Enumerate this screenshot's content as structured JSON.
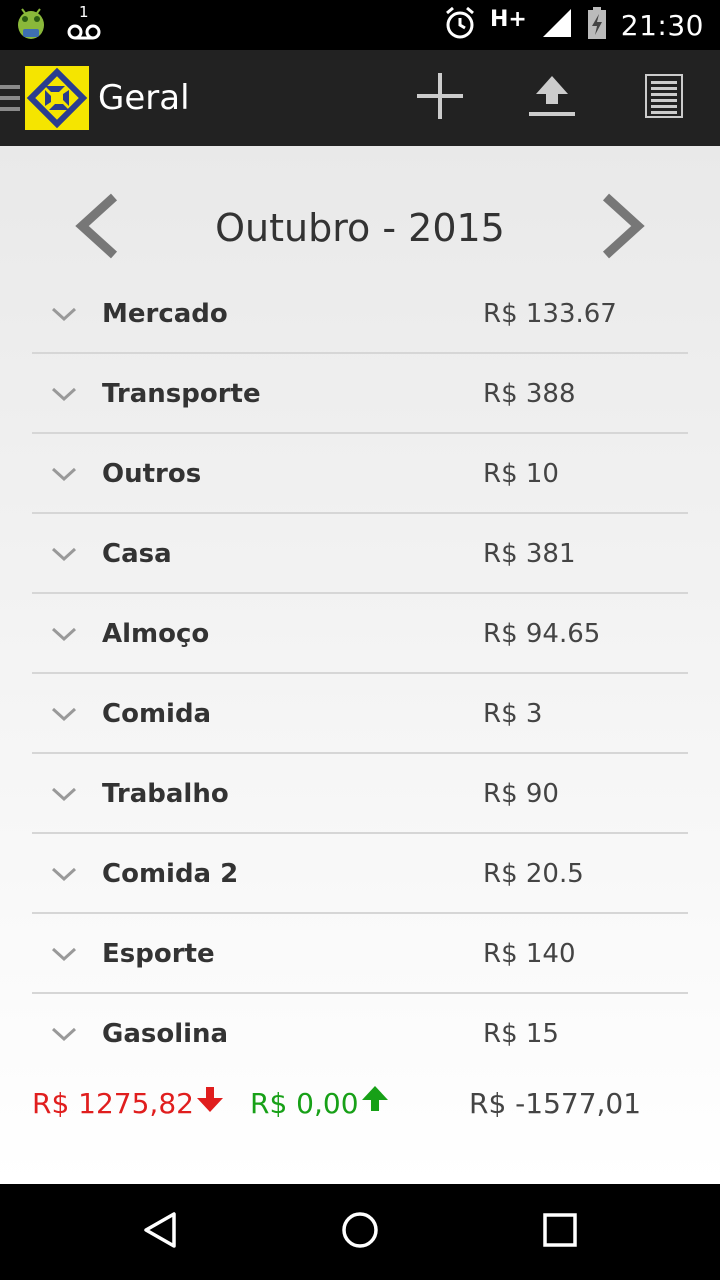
{
  "status_bar": {
    "voicemail_count": "1",
    "network_type": "H+",
    "time": "21:30",
    "icons": [
      "android-debug-icon",
      "voicemail-icon",
      "alarm-icon",
      "signal-icon",
      "battery-charging-icon"
    ]
  },
  "action_bar": {
    "title": "Geral",
    "icons": [
      "drawer-menu-icon",
      "app-logo",
      "add-icon",
      "upload-icon",
      "list-icon"
    ]
  },
  "month_nav": {
    "label": "Outubro - 2015"
  },
  "categories": [
    {
      "name": "Mercado",
      "value": "R$ 133.67"
    },
    {
      "name": "Transporte",
      "value": "R$ 388"
    },
    {
      "name": "Outros",
      "value": "R$ 10"
    },
    {
      "name": "Casa",
      "value": "R$ 381"
    },
    {
      "name": "Almoço",
      "value": "R$ 94.65"
    },
    {
      "name": "Comida",
      "value": "R$ 3"
    },
    {
      "name": "Trabalho",
      "value": "R$ 90"
    },
    {
      "name": "Comida 2",
      "value": "R$ 20.5"
    },
    {
      "name": "Esporte",
      "value": "R$ 140"
    },
    {
      "name": "Gasolina",
      "value": "R$ 15"
    }
  ],
  "totals": {
    "expenses": "R$ 1275,82",
    "income": "R$ 0,00",
    "balance": "R$ -1577,01"
  },
  "colors": {
    "expense": "#e01e1e",
    "income": "#17a017",
    "action_bar": "#222222",
    "logo_yellow": "#f5e500",
    "logo_blue": "#2a3c8f"
  }
}
